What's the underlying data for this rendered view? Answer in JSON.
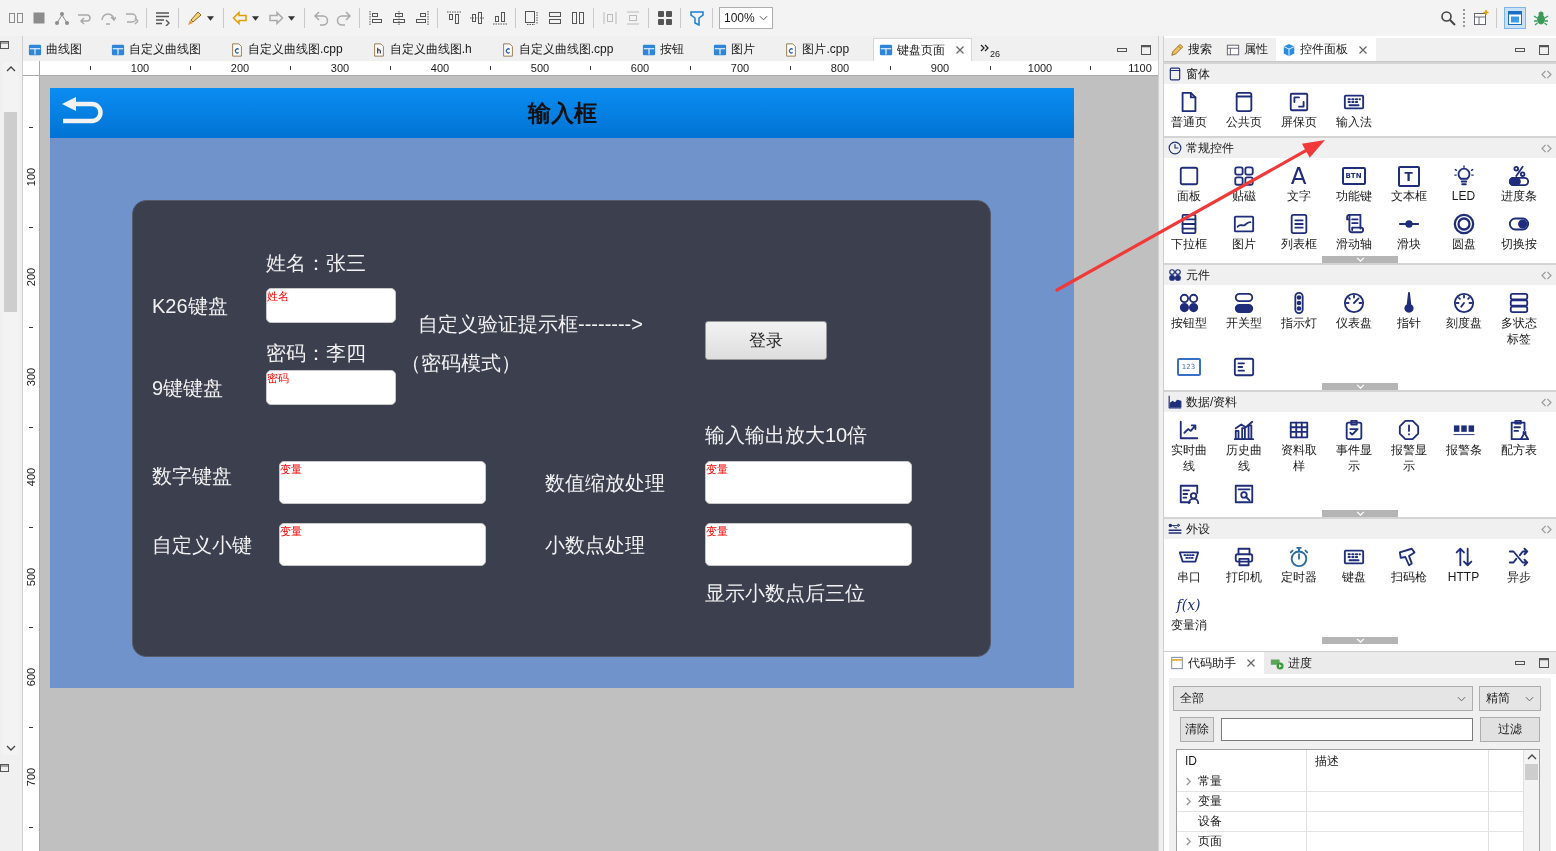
{
  "toolbar": {
    "zoom": "100%"
  },
  "editor": {
    "tabs": [
      {
        "label": "曲线图",
        "kind": "page",
        "selected": false
      },
      {
        "label": "自定义曲线图",
        "kind": "page",
        "selected": false
      },
      {
        "label": "自定义曲线图.cpp",
        "kind": "source",
        "selected": false
      },
      {
        "label": "自定义曲线图.h",
        "kind": "header",
        "selected": false
      },
      {
        "label": "自定义曲线图.cpp",
        "kind": "source",
        "selected": false
      },
      {
        "label": "按钮",
        "kind": "page",
        "selected": false
      },
      {
        "label": "图片",
        "kind": "page",
        "selected": false
      },
      {
        "label": "图片.cpp",
        "kind": "source",
        "selected": false
      },
      {
        "label": "键盘页面",
        "kind": "page",
        "selected": true
      }
    ],
    "hidden_tab_count": "26",
    "ruler": {
      "x_labels": [
        "100",
        "200",
        "300",
        "400",
        "500",
        "600",
        "700",
        "800",
        "900",
        "1000",
        "1100"
      ],
      "y_labels": [
        "100",
        "200",
        "300",
        "400",
        "500",
        "600",
        "700"
      ]
    },
    "page": {
      "title": "输入框",
      "widgets": [
        {
          "kind": "text",
          "text": "姓名：张三"
        },
        {
          "kind": "text",
          "text": "K26键盘"
        },
        {
          "kind": "input",
          "tag": "姓名"
        },
        {
          "kind": "text",
          "text": "自定义验证提示框-------->"
        },
        {
          "kind": "button",
          "label": "登录"
        },
        {
          "kind": "text",
          "text": "密码：李四"
        },
        {
          "kind": "text",
          "text": "（密码模式）"
        },
        {
          "kind": "text",
          "text": "9键键盘"
        },
        {
          "kind": "input",
          "tag": "密码"
        },
        {
          "kind": "text",
          "text": "输入输出放大10倍"
        },
        {
          "kind": "text",
          "text": "数字键盘"
        },
        {
          "kind": "input",
          "tag": "变量"
        },
        {
          "kind": "text",
          "text": "数值缩放处理"
        },
        {
          "kind": "input",
          "tag": "变量"
        },
        {
          "kind": "text",
          "text": "自定义小键"
        },
        {
          "kind": "input",
          "tag": "变量"
        },
        {
          "kind": "text",
          "text": "小数点处理"
        },
        {
          "kind": "input",
          "tag": "变量"
        },
        {
          "kind": "text",
          "text": "显示小数点后三位"
        }
      ]
    }
  },
  "palette": {
    "tabs": [
      {
        "label": "搜索",
        "selected": false
      },
      {
        "label": "属性",
        "selected": false
      },
      {
        "label": "控件面板",
        "selected": true
      }
    ],
    "sections": [
      {
        "title": "窗体",
        "has_more": false,
        "items": [
          {
            "label": "普通页"
          },
          {
            "label": "公共页"
          },
          {
            "label": "屏保页"
          },
          {
            "label": "输入法"
          }
        ]
      },
      {
        "title": "常规控件",
        "has_more": true,
        "items": [
          {
            "label": "面板"
          },
          {
            "label": "贴磁"
          },
          {
            "label": "文字",
            "glyph": "A"
          },
          {
            "label": "功能键",
            "glyph": "BTN"
          },
          {
            "label": "文本框",
            "glyph": "T"
          },
          {
            "label": "LED"
          },
          {
            "label": "进度条"
          },
          {
            "label": "下拉框"
          },
          {
            "label": "图片"
          },
          {
            "label": "列表框"
          },
          {
            "label": "滑动轴"
          },
          {
            "label": "滑块"
          },
          {
            "label": "圆盘"
          },
          {
            "label": "切换按"
          }
        ]
      },
      {
        "title": "元件",
        "has_more": true,
        "items": [
          {
            "kind": "tile",
            "label": "按钮型"
          },
          {
            "kind": "tile",
            "label": "开关型"
          },
          {
            "kind": "tile",
            "label": "指示灯"
          },
          {
            "kind": "tile",
            "label": "仪表盘"
          },
          {
            "kind": "tile",
            "label": "指针"
          },
          {
            "kind": "tile",
            "label": "刻度盘"
          },
          {
            "kind": "tile",
            "label": "多状态标签"
          },
          {
            "kind": "icon",
            "glyph": "123"
          },
          {
            "kind": "icon"
          }
        ]
      },
      {
        "title": "数据/资料",
        "has_more": true,
        "items": [
          {
            "kind": "tile",
            "label": "实时曲线"
          },
          {
            "kind": "tile",
            "label": "历史曲线"
          },
          {
            "kind": "tile",
            "label": "资料取样"
          },
          {
            "kind": "tile",
            "label": "事件显示"
          },
          {
            "kind": "tile",
            "label": "报警显示"
          },
          {
            "kind": "tile",
            "label": "报警条"
          },
          {
            "kind": "tile",
            "label": "配方表"
          },
          {
            "kind": "icon"
          },
          {
            "kind": "icon"
          }
        ]
      },
      {
        "title": "外设",
        "has_more": true,
        "items": [
          {
            "label": "串口"
          },
          {
            "label": "打印机"
          },
          {
            "label": "定时器"
          },
          {
            "label": "键盘"
          },
          {
            "label": "扫码枪"
          },
          {
            "label": "HTTP"
          },
          {
            "label": "异步"
          },
          {
            "label": "变量消",
            "glyph": "f(x)"
          }
        ]
      }
    ]
  },
  "code_assistant": {
    "tabs": [
      {
        "label": "代码助手",
        "selected": true
      },
      {
        "label": "进度",
        "selected": false
      }
    ],
    "scope": "全部",
    "mode": "精简",
    "clear_button": "清除",
    "filter_button": "过滤",
    "columns": [
      "ID",
      "描述"
    ],
    "rows": [
      {
        "label": "常量",
        "expandable": true
      },
      {
        "label": "变量",
        "expandable": true
      },
      {
        "label": "设备",
        "expandable": false
      },
      {
        "label": "页面",
        "expandable": true
      }
    ]
  }
}
